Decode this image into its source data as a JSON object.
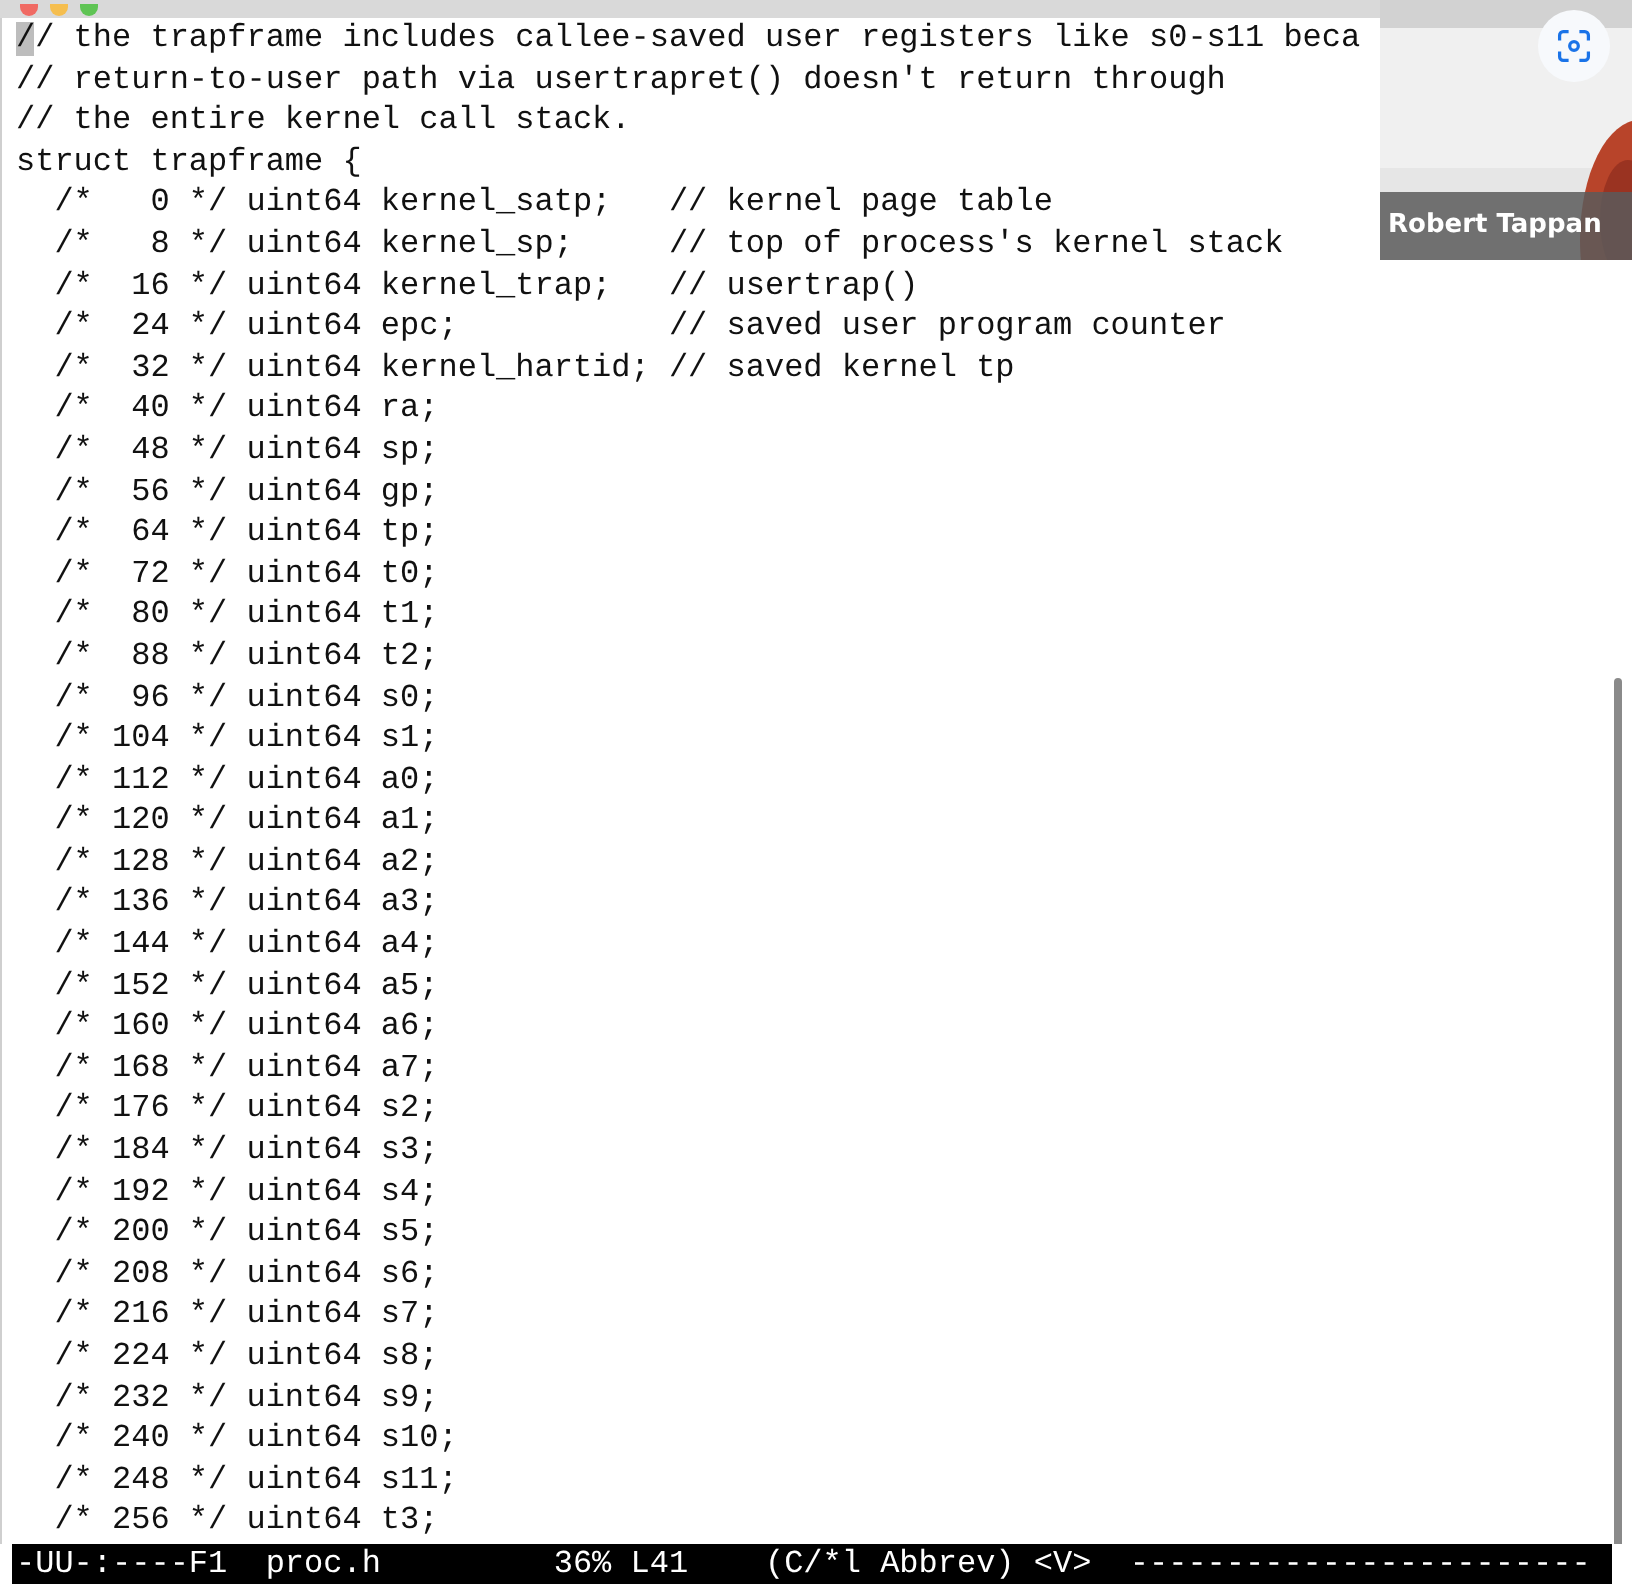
{
  "editor": {
    "lines": [
      "// the trapframe includes callee-saved user registers like s0-s11 beca",
      "// return-to-user path via usertrapret() doesn't return through",
      "// the entire kernel call stack.",
      "struct trapframe {",
      "  /*   0 */ uint64 kernel_satp;   // kernel page table",
      "  /*   8 */ uint64 kernel_sp;     // top of process's kernel stack",
      "  /*  16 */ uint64 kernel_trap;   // usertrap()",
      "  /*  24 */ uint64 epc;           // saved user program counter",
      "  /*  32 */ uint64 kernel_hartid; // saved kernel tp",
      "  /*  40 */ uint64 ra;",
      "  /*  48 */ uint64 sp;",
      "  /*  56 */ uint64 gp;",
      "  /*  64 */ uint64 tp;",
      "  /*  72 */ uint64 t0;",
      "  /*  80 */ uint64 t1;",
      "  /*  88 */ uint64 t2;",
      "  /*  96 */ uint64 s0;",
      "  /* 104 */ uint64 s1;",
      "  /* 112 */ uint64 a0;",
      "  /* 120 */ uint64 a1;",
      "  /* 128 */ uint64 a2;",
      "  /* 136 */ uint64 a3;",
      "  /* 144 */ uint64 a4;",
      "  /* 152 */ uint64 a5;",
      "  /* 160 */ uint64 a6;",
      "  /* 168 */ uint64 a7;",
      "  /* 176 */ uint64 s2;",
      "  /* 184 */ uint64 s3;",
      "  /* 192 */ uint64 s4;",
      "  /* 200 */ uint64 s5;",
      "  /* 208 */ uint64 s6;",
      "  /* 216 */ uint64 s7;",
      "  /* 224 */ uint64 s8;",
      "  /* 232 */ uint64 s9;",
      "  /* 240 */ uint64 s10;",
      "  /* 248 */ uint64 s11;",
      "  /* 256 */ uint64 t3;"
    ],
    "mode_line": "-UU-:----F1  proc.h         36% L41    (C/*l Abbrev) <V>  ------------------------"
  },
  "video_overlay": {
    "kind": "picture",
    "speaker_name": "Robert Tappan"
  }
}
